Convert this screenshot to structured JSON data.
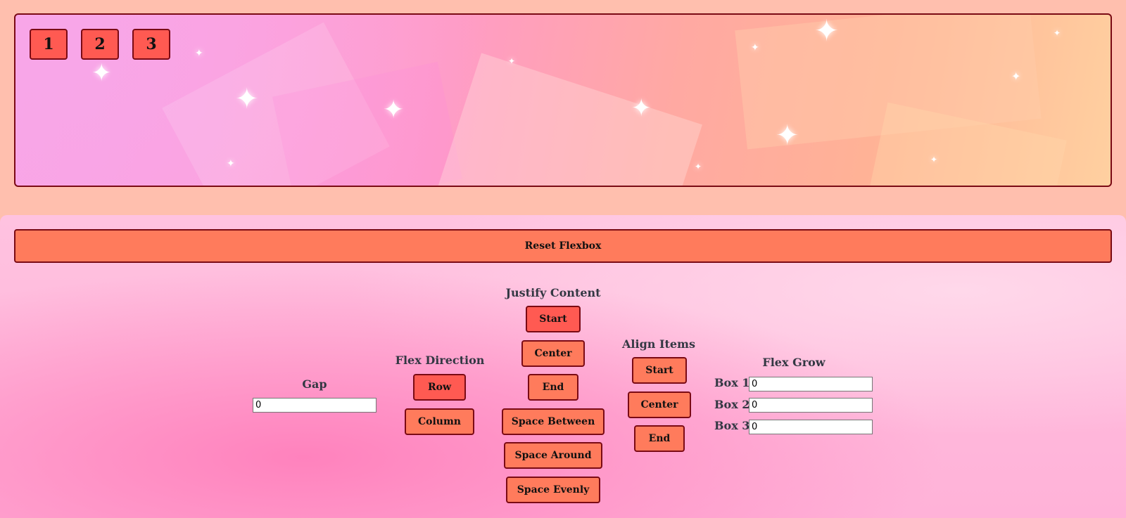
{
  "stage": {
    "boxes": [
      "1",
      "2",
      "3"
    ]
  },
  "controls": {
    "reset_label": "Reset Flexbox",
    "gap": {
      "heading": "Gap",
      "value": "0"
    },
    "flex_direction": {
      "heading": "Flex Direction",
      "options": [
        "Row",
        "Column"
      ],
      "selected": "Row"
    },
    "justify_content": {
      "heading": "Justify Content",
      "options": [
        "Start",
        "Center",
        "End",
        "Space Between",
        "Space Around",
        "Space Evenly"
      ],
      "selected": "Start"
    },
    "align_items": {
      "heading": "Align Items",
      "options": [
        "Start",
        "Center",
        "End"
      ]
    },
    "flex_grow": {
      "heading": "Flex Grow",
      "rows": [
        {
          "label": "Box 1",
          "value": "0"
        },
        {
          "label": "Box 2",
          "value": "0"
        },
        {
          "label": "Box 3",
          "value": "0"
        }
      ]
    }
  },
  "colors": {
    "button": "#ff7b5c",
    "button_active": "#ff5a52",
    "border": "#7a0a14",
    "heading_text": "#333843"
  }
}
